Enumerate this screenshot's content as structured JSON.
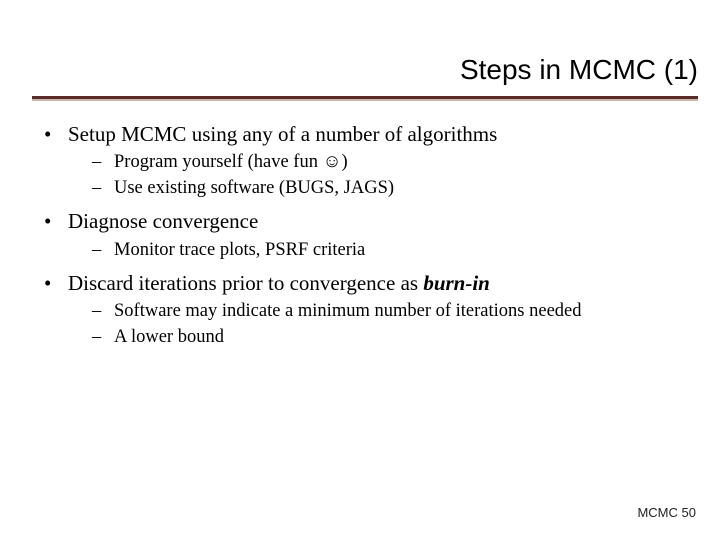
{
  "title": "Steps in MCMC (1)",
  "bullets": [
    {
      "text": "Setup MCMC using any of a number of algorithms",
      "sub": [
        "Program yourself (have fun ☺)",
        "Use existing software (BUGS, JAGS)"
      ]
    },
    {
      "text": "Diagnose convergence",
      "sub": [
        "Monitor trace plots, PSRF criteria"
      ]
    },
    {
      "text_pre": "Discard iterations prior to convergence as ",
      "text_em": "burn-in",
      "sub": [
        "Software may indicate a minimum number of iterations needed",
        "A lower bound"
      ]
    }
  ],
  "footer": {
    "label": "MCMC",
    "page": "50"
  }
}
